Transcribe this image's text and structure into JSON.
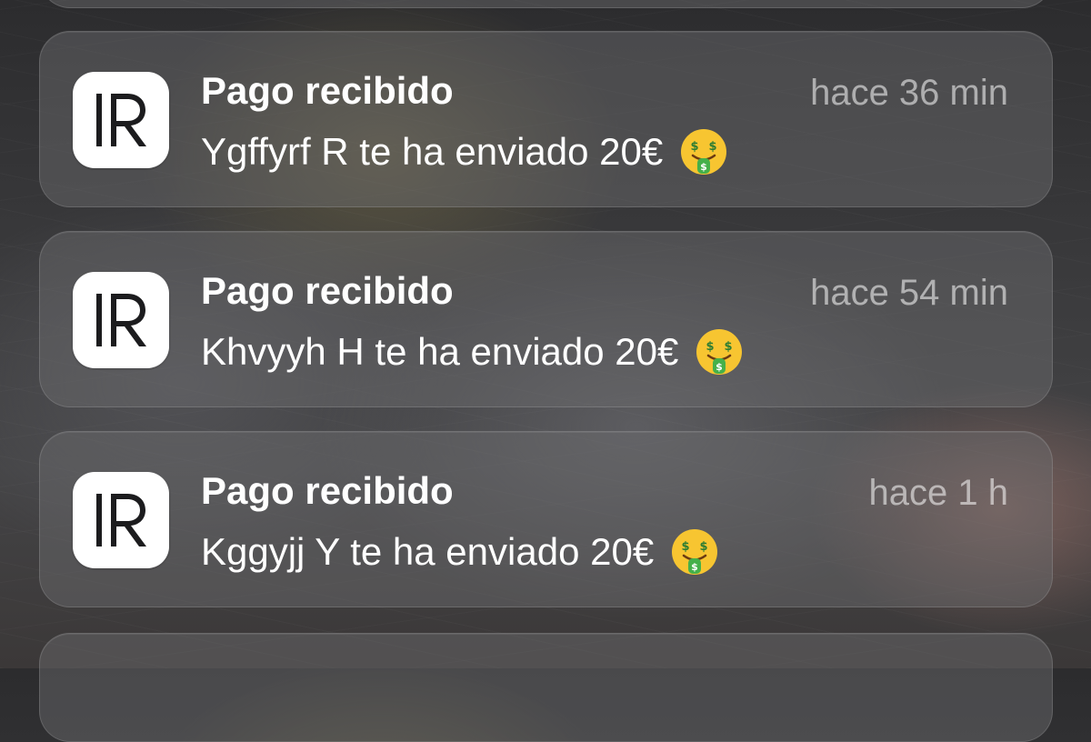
{
  "colors": {
    "card_bg": "rgba(110,110,112,0.46)",
    "title": "#ffffff",
    "time": "rgba(255,255,255,0.55)",
    "app_icon_bg": "#ffffff",
    "app_icon_glyph": "#1c1c1e"
  },
  "notifications": [
    {
      "app_icon": "revolut-r-icon",
      "title": "Pago recibido",
      "time": "hace 36 min",
      "message": "Ygffyrf R te ha enviado 20€",
      "emoji": "money-mouth-face-icon"
    },
    {
      "app_icon": "revolut-r-icon",
      "title": "Pago recibido",
      "time": "hace 54 min",
      "message": "Khvyyh H te ha enviado 20€",
      "emoji": "money-mouth-face-icon"
    },
    {
      "app_icon": "revolut-r-icon",
      "title": "Pago recibido",
      "time": "hace 1 h",
      "message": "Kggyjj Y te ha enviado 20€",
      "emoji": "money-mouth-face-icon"
    }
  ]
}
